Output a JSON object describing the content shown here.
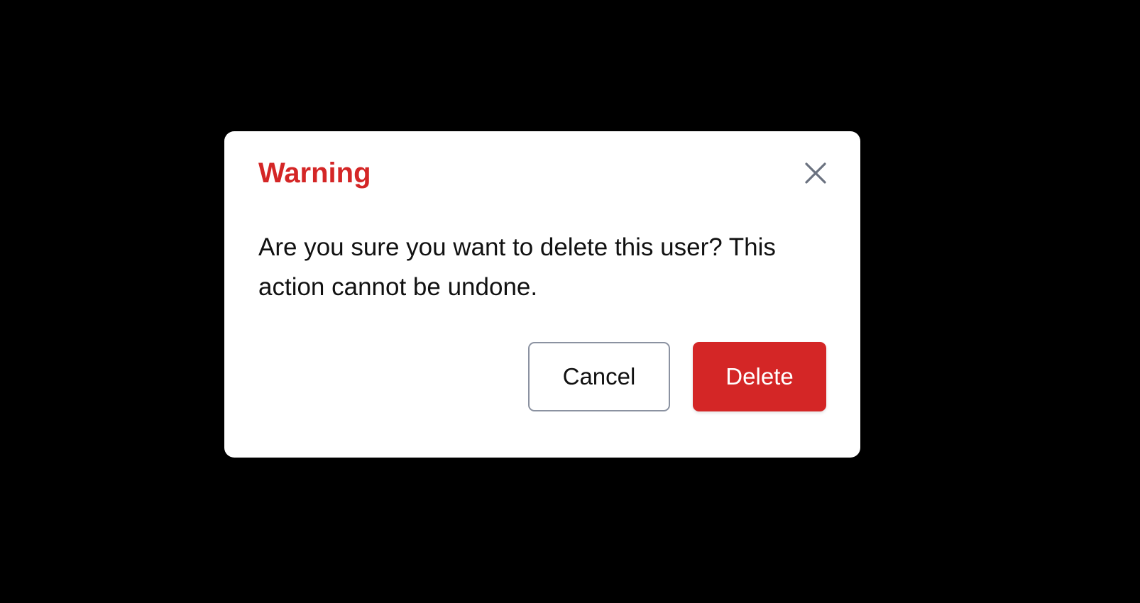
{
  "dialog": {
    "title": "Warning",
    "message": "Are you sure you want to delete this user? This action cannot be undone.",
    "close_icon": "close-icon",
    "cancel_label": "Cancel",
    "delete_label": "Delete"
  },
  "colors": {
    "overlay": "#000000",
    "dialog_background": "#ffffff",
    "accent_danger": "#d42626",
    "close_icon": "#6b7280",
    "cancel_border": "#8b92a1",
    "text": "#111111"
  }
}
